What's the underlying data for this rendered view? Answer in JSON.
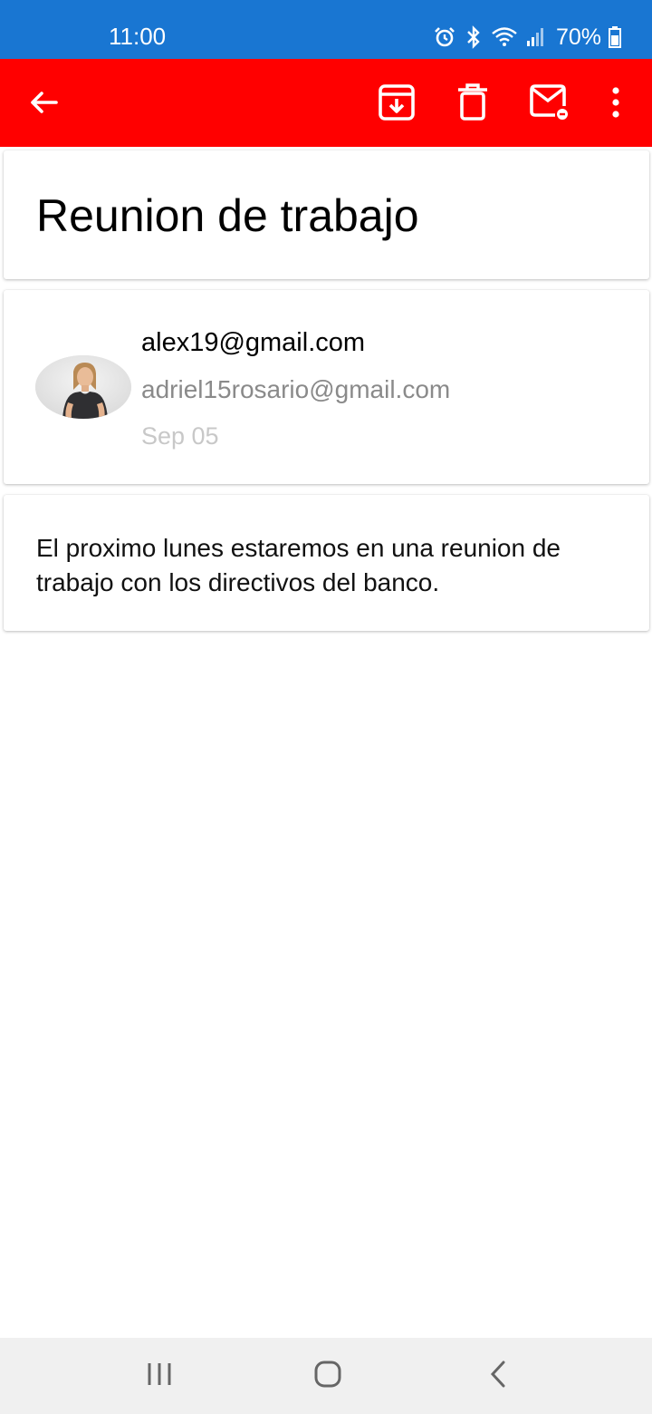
{
  "status_bar": {
    "time": "11:00",
    "battery": "70%",
    "icons": [
      "alarm-icon",
      "bluetooth-icon",
      "wifi-icon",
      "signal-icon",
      "battery-icon"
    ]
  },
  "toolbar": {
    "color": "#ff0000",
    "icons": [
      "back-arrow-icon",
      "archive-icon",
      "delete-icon",
      "mark-unread-icon",
      "more-options-icon"
    ]
  },
  "email": {
    "subject": "Reunion de trabajo",
    "from": "alex19@gmail.com",
    "to": "adriel15rosario@gmail.com",
    "date": "Sep 05",
    "body": "El proximo lunes estaremos en una reunion de trabajo con los directivos del banco."
  },
  "nav_bar": {
    "icons": [
      "recent-apps-icon",
      "home-icon",
      "back-icon"
    ]
  },
  "colors": {
    "status_bar": "#1976d2",
    "toolbar": "#ff0000",
    "nav_bar": "#f0f0f0"
  }
}
